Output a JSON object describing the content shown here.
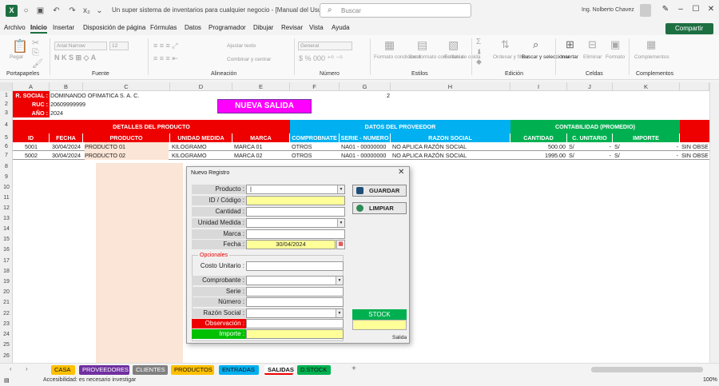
{
  "title": "Un super sistema de inventarios para cualquier negocio - [Manual del Usuario] - E...",
  "search": "Buscar",
  "user": "Ing. Nolberto Chavez",
  "menu": [
    "Archivo",
    "Inicio",
    "Insertar",
    "Disposición de página",
    "Fórmulas",
    "Datos",
    "Programador",
    "Dibujar",
    "Revisar",
    "Vista",
    "Ayuda"
  ],
  "share": "Compartir",
  "ribbon": {
    "pegar": "Pegar",
    "portapapeles": "Portapapeles",
    "font": "Arial Narrow",
    "size": "12",
    "fuente": "Fuente",
    "ajustar": "Ajustar texto",
    "combinar": "Combinar y centrar",
    "alineacion": "Alineación",
    "general": "General",
    "numero": "Número",
    "formato_cond": "Formato\ncondicional",
    "dar_formato": "Dar formato\ncomo tabla",
    "estilos_celda": "Estilos de\ncelda",
    "estilos": "Estilos",
    "ordenar": "Ordenar y\nfiltrar",
    "buscar": "Buscar y\nseleccionar",
    "edicion": "Edición",
    "insertar": "Insertar",
    "eliminar": "Eliminar",
    "formato": "Formato",
    "celdas": "Celdas",
    "complementos": "Complementos",
    "complementos_g": "Complementos"
  },
  "columns": [
    "A",
    "B",
    "C",
    "D",
    "E",
    "F",
    "G",
    "H",
    "I",
    "J",
    "K"
  ],
  "rows": [
    "1",
    "2",
    "3",
    "4",
    "5",
    "6",
    "7",
    "8",
    "9",
    "10",
    "11",
    "12",
    "13",
    "14",
    "15",
    "16",
    "17",
    "18",
    "19",
    "20",
    "21",
    "22",
    "23",
    "24",
    "25",
    "26"
  ],
  "sheet": {
    "r_social_lbl": "R. SOCIAL :",
    "r_social": "DOMINANDO OFIMATICA S. A. C.",
    "ruc_lbl": "RUC :",
    "ruc": "20609999999",
    "anio_lbl": "AÑO :",
    "anio": "2024",
    "g1": "2",
    "nueva": "NUEVA SALIDA",
    "detalles": "DETALLES DEL PRODUCTO",
    "proveedor": "DATOS DEL PROVEEDOR",
    "contab": "CONTABILIDAD (PROMEDIO)",
    "headers": [
      "ID",
      "FECHA",
      "PRODUCTO",
      "UNIDAD MEDIDA",
      "MARCA",
      "COMPROBNATE",
      "SERIE - NUMERO",
      "RAZON SOCIAL",
      "CANTIDAD",
      "C. UNITARIO",
      "IMPORTE"
    ],
    "data": [
      [
        "5001",
        "30/04/2024",
        "PRODUCTO 01",
        "KILOGRAMO",
        "MARCA 01",
        "OTROS",
        "NA01 - 00000000",
        "NO APLICA RAZÓN SOCIAL",
        "500.00",
        "S/",
        "-",
        "S/",
        "-",
        "SIN OBSE"
      ],
      [
        "5002",
        "30/04/2024",
        "PRODUCTO 02",
        "KILOGRAMO",
        "MARCA 02",
        "OTROS",
        "NA01 - 00000000",
        "NO APLICA RAZÓN SOCIAL",
        "1995.00",
        "S/",
        "-",
        "S/",
        "-",
        "SIN OBSE"
      ]
    ]
  },
  "dialog": {
    "title": "Nuevo Registro",
    "labels": [
      "Producto :",
      "ID / Código :",
      "Cantidad :",
      "Unidad Medida :",
      "Marca :",
      "Fecha :"
    ],
    "fecha": "30/04/2024",
    "opcionales": "Opcionales",
    "opt_labels": [
      "Costo Unitario :",
      "Comprobante :",
      "Serie :",
      "Número :",
      "Razón Social :",
      "Observación :",
      "Importe :"
    ],
    "guardar": "GUARDAR",
    "limpiar": "LIMPIAR",
    "stock": "STOCK",
    "salida": "Salida"
  },
  "tabs": [
    "CASA",
    "PROVEEDORES",
    "CLIENTES",
    "PRODUCTOS",
    "ENTRADAS",
    "SALIDAS",
    "D.STOCK"
  ],
  "tab_colors": [
    "#ffc000",
    "#7030a0",
    "#808080",
    "#ffc000",
    "#00b0f0",
    "#ffffff",
    "#00b050"
  ],
  "status": "Accesibilidad: es necesario investigar",
  "zoom": "100%"
}
